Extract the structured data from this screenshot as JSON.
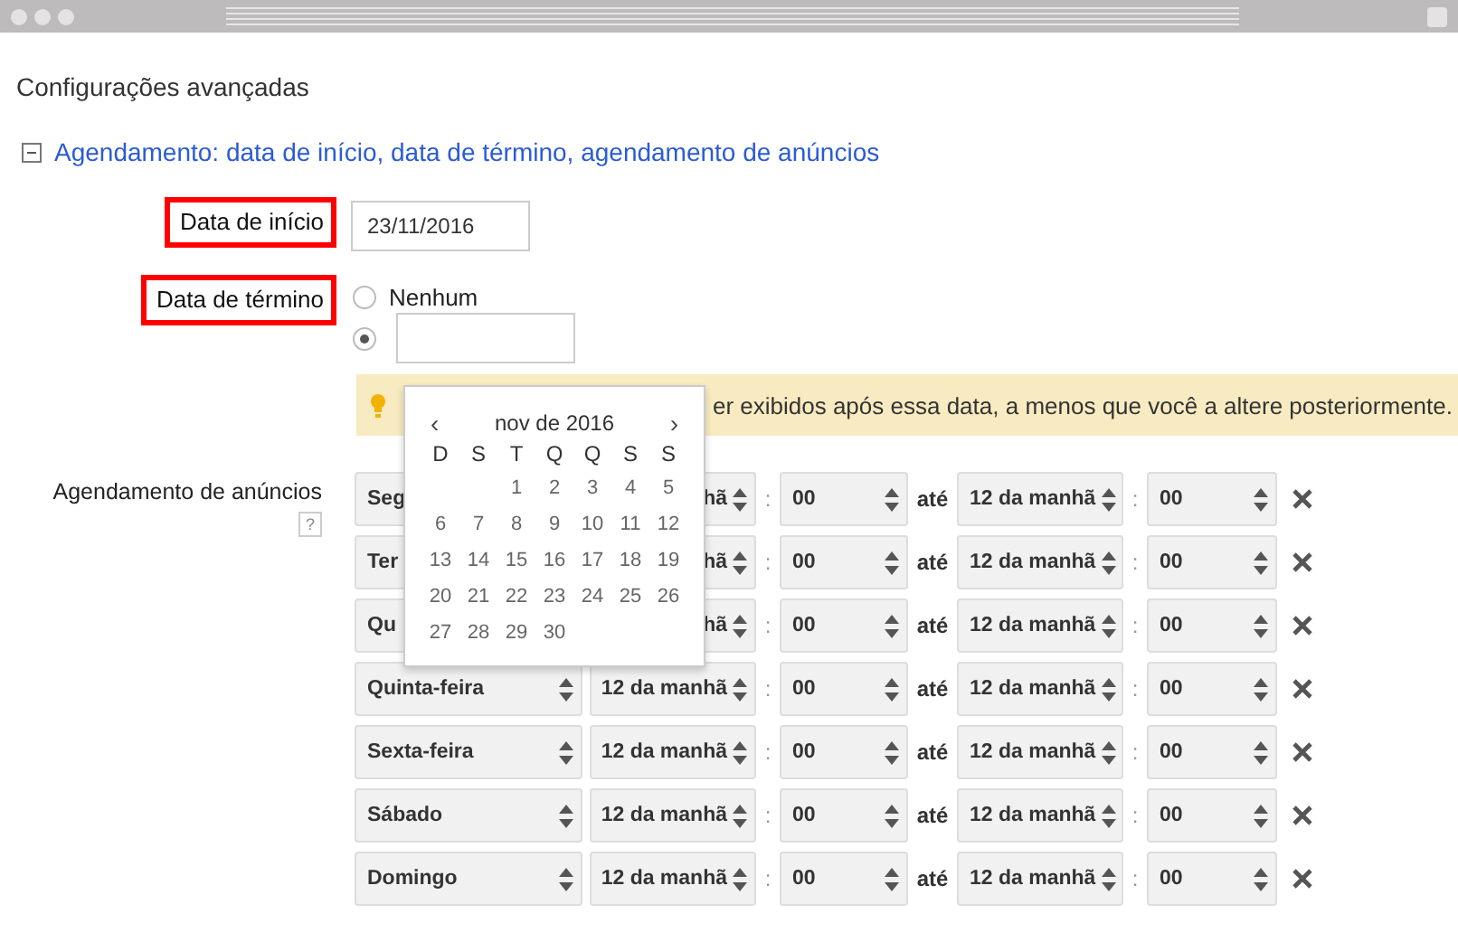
{
  "heading": "Configurações avançadas",
  "section": {
    "expanded": true,
    "label": "Agendamento: data de início, data de término, agendamento de anúncios"
  },
  "start_date": {
    "label": "Data de início",
    "value": "23/11/2016"
  },
  "end_date": {
    "label": "Data de término",
    "options": [
      {
        "kind": "none",
        "label": "Nenhum",
        "selected": false
      },
      {
        "kind": "date",
        "selected": true
      }
    ]
  },
  "notice": {
    "text": "er exibidos após essa data, a menos que você a altere posteriormente."
  },
  "calendar": {
    "prev": "‹",
    "month": "nov de 2016",
    "next": "›",
    "weekdays": [
      "D",
      "S",
      "T",
      "Q",
      "Q",
      "S",
      "S"
    ],
    "weeks": [
      {
        "kind": "trailing",
        "days": [
          "1",
          "2",
          "3",
          "4",
          "5"
        ]
      },
      {
        "kind": "leading",
        "days": [
          "6",
          "7",
          "8",
          "9",
          "10",
          "11",
          "12"
        ]
      },
      {
        "kind": "leading",
        "days": [
          "13",
          "14",
          "15",
          "16",
          "17",
          "18",
          "19"
        ]
      },
      {
        "kind": "leading",
        "days": [
          "20",
          "21",
          "22",
          "23",
          "24",
          "25",
          "26"
        ]
      },
      {
        "kind": "leading",
        "days": [
          "27",
          "28",
          "29",
          "30"
        ]
      }
    ]
  },
  "schedule": {
    "label": "Agendamento de anúncios",
    "help": "?",
    "rows": [
      {
        "kind": "covered",
        "day": "Seg",
        "start_hour": "hã",
        "colon_1": ":",
        "start_minute": "00",
        "until": "até",
        "end_hour": "12 da manhã",
        "colon_2": ":",
        "end_minute": "00"
      },
      {
        "kind": "covered",
        "day": "Ter",
        "start_hour": "hã",
        "colon_1": ":",
        "start_minute": "00",
        "until": "até",
        "end_hour": "12 da manhã",
        "colon_2": ":",
        "end_minute": "00"
      },
      {
        "kind": "covered",
        "day": "Qu",
        "start_hour": "hã",
        "colon_1": ":",
        "start_minute": "00",
        "until": "até",
        "end_hour": "12 da manhã",
        "colon_2": ":",
        "end_minute": "00"
      },
      {
        "kind": "full",
        "day": "Quinta-feira",
        "start_hour": "12 da manhã",
        "colon_1": ":",
        "start_minute": "00",
        "until": "até",
        "end_hour": "12 da manhã",
        "colon_2": ":",
        "end_minute": "00"
      },
      {
        "kind": "full",
        "day": "Sexta-feira",
        "start_hour": "12 da manhã",
        "colon_1": ":",
        "start_minute": "00",
        "until": "até",
        "end_hour": "12 da manhã",
        "colon_2": ":",
        "end_minute": "00"
      },
      {
        "kind": "full",
        "day": "Sábado",
        "start_hour": "12 da manhã",
        "colon_1": ":",
        "start_minute": "00",
        "until": "até",
        "end_hour": "12 da manhã",
        "colon_2": ":",
        "end_minute": "00"
      },
      {
        "kind": "full",
        "day": "Domingo",
        "start_hour": "12 da manhã",
        "colon_1": ":",
        "start_minute": "00",
        "until": "até",
        "end_hour": "12 da manhã",
        "colon_2": ":",
        "end_minute": "00"
      }
    ]
  }
}
